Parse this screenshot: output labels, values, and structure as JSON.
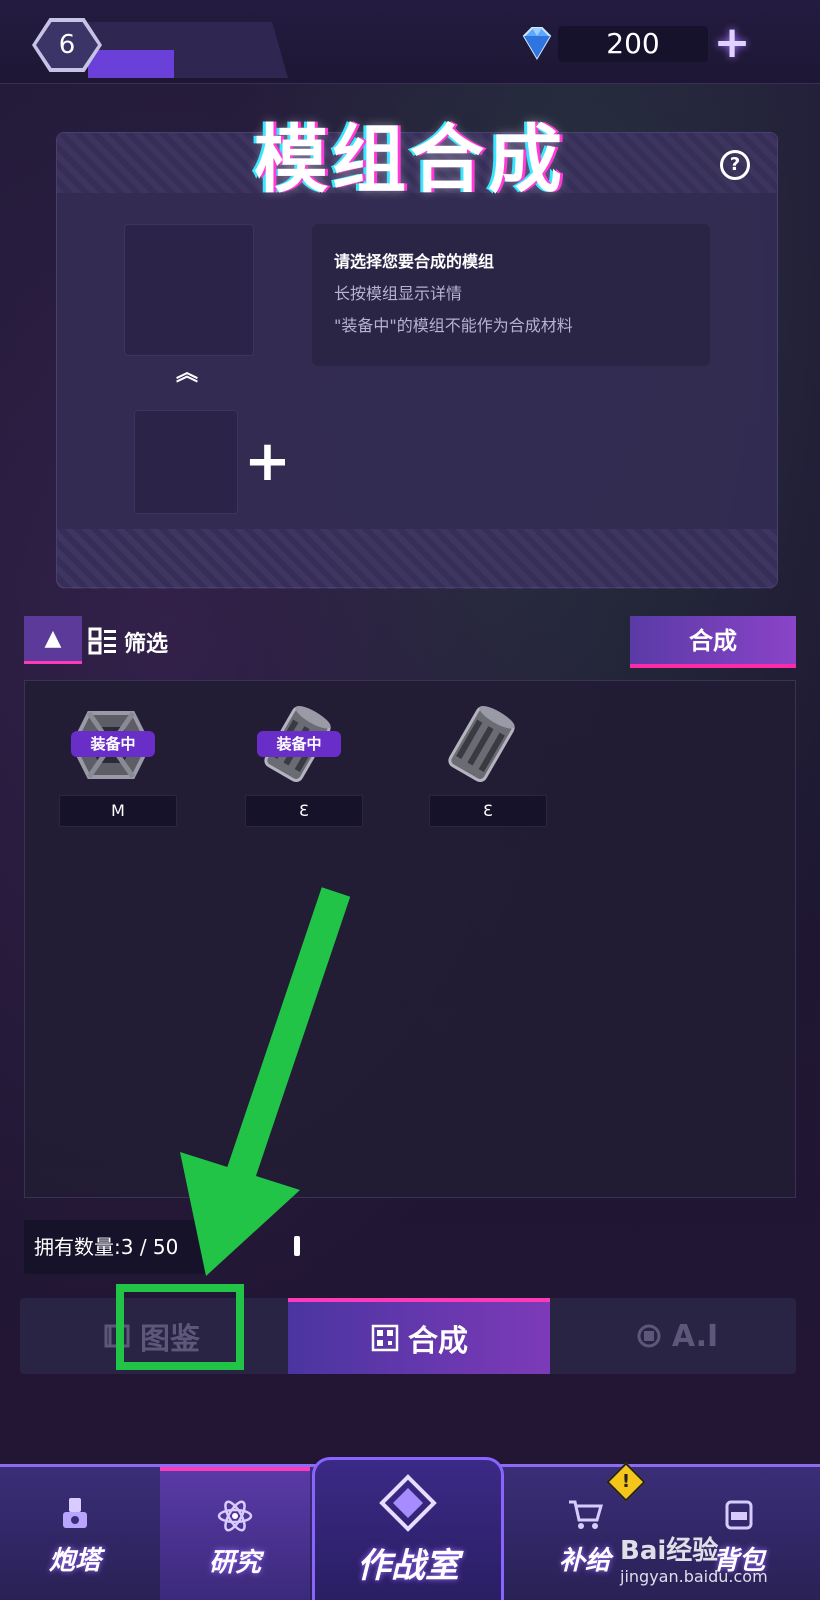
{
  "header": {
    "level": "6",
    "gems": "200",
    "gem_plus": "+"
  },
  "panel": {
    "title": "模组合成",
    "help": "?",
    "chevrons": "︽",
    "plus": "+",
    "info": [
      "请选择您要合成的模组",
      "长按模组显示详情",
      "\"装备中\"的模组不能作为合成材料"
    ]
  },
  "filter": {
    "sort_arrow": "▲",
    "label": "筛选",
    "synth_button": "合成"
  },
  "items": [
    {
      "icon": "frame-module-icon",
      "badge": "装备中",
      "count": "M"
    },
    {
      "icon": "cylinder-module-icon",
      "badge": "装备中",
      "count": "3"
    },
    {
      "icon": "cylinder-module-icon",
      "badge": "",
      "count": "3"
    }
  ],
  "owned": "拥有数量:3  / 50",
  "tabs": [
    {
      "label": "图鉴",
      "icon": "book-icon",
      "active": false
    },
    {
      "label": "合成",
      "icon": "qr-grid-icon",
      "active": true
    },
    {
      "label": "A.I",
      "icon": "chip-icon",
      "active": false
    }
  ],
  "nav": [
    {
      "label": "炮塔",
      "icon": "turret-icon"
    },
    {
      "label": "研究",
      "icon": "atom-icon"
    },
    {
      "label": "作战室",
      "icon": "diamond-emblem-icon"
    },
    {
      "label": "补给",
      "icon": "cart-icon"
    },
    {
      "label": "背包",
      "icon": "backpack-icon"
    }
  ],
  "warning_badge": "!",
  "watermark": {
    "brand": "Bai经验",
    "url": "jingyan.baidu.com"
  },
  "colors": {
    "accent_pink": "#ff3ab8",
    "accent_purple": "#6a40d8",
    "annotation_green": "#22c447"
  }
}
